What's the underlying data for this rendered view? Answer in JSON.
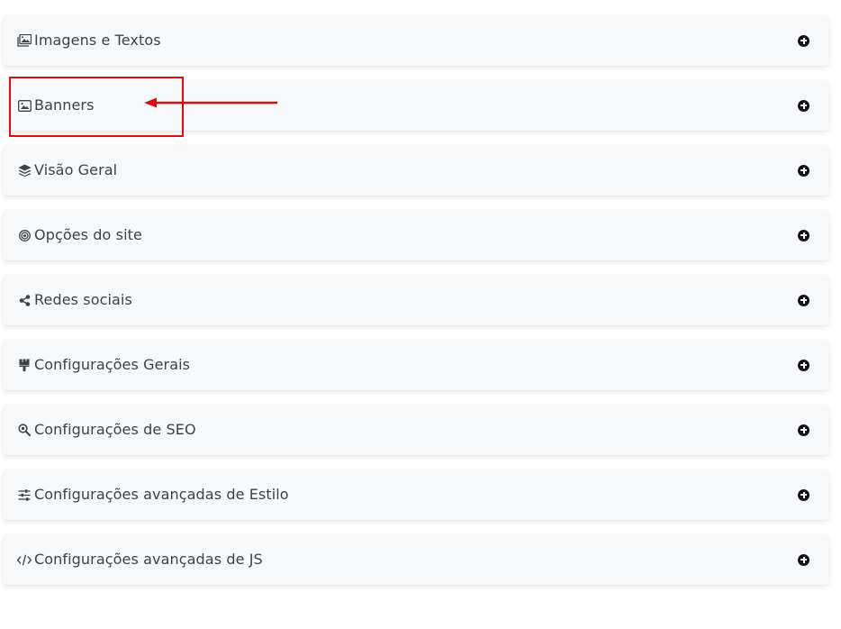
{
  "panels": [
    {
      "label": "Imagens e Textos",
      "icon": "images-icon"
    },
    {
      "label": "Banners",
      "icon": "image-icon"
    },
    {
      "label": "Visão Geral",
      "icon": "layers-icon"
    },
    {
      "label": "Opções do site",
      "icon": "bullseye-icon"
    },
    {
      "label": "Redes sociais",
      "icon": "share-icon"
    },
    {
      "label": "Configurações Gerais",
      "icon": "paint-brush-icon"
    },
    {
      "label": "Configurações de SEO",
      "icon": "search-icon"
    },
    {
      "label": "Configurações avançadas de Estilo",
      "icon": "sliders-icon"
    },
    {
      "label": "Configurações avançadas de JS",
      "icon": "code-icon"
    }
  ],
  "toggle_icon": "plus-circle-icon",
  "colors": {
    "panel_background": "#f7f8fa",
    "label_text": "#3d4148",
    "toggle": "#111317",
    "annotation": "#d90d0d"
  }
}
